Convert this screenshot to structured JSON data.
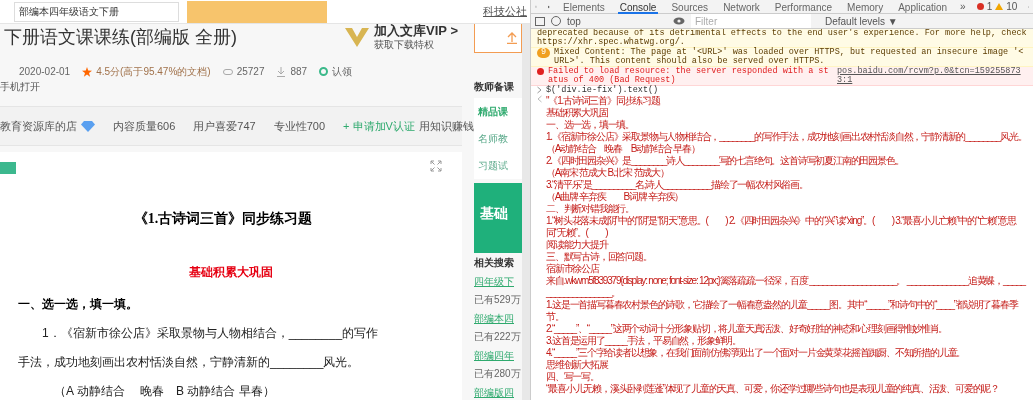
{
  "page": {
    "search_field": {
      "value": "部编本四年级语文下册"
    },
    "top_link": "科技公社",
    "doc_title": "下册语文课课练(部编版 全册)",
    "vip": {
      "title": "加入文库VIP >",
      "subtitle": "获取下载特权"
    },
    "meta": {
      "date": "2020-02-01",
      "rating": "4.5分(高于95.47%的文档)",
      "views": "25727",
      "downloads": "887",
      "claim": "认领",
      "mobile": "手机打开"
    },
    "shop_bar": {
      "shop": "教育资源库的店",
      "stats": [
        "内容质量606",
        "用户喜爱747",
        "专业性700"
      ],
      "apply": "+ 申请加V认证",
      "earn": "用知识赚钱"
    },
    "document": {
      "title": "《1.古诗词三首》同步练习题",
      "section": "基础积累大巩固",
      "heading": "一、选一选，填一填。",
      "lines": [
        {
          "kind": "indent",
          "text": "1．《宿新市徐公店》采取景物与人物相结合，________的写作"
        },
        {
          "kind": "plain",
          "text": "手法，成功地刻画出农村恬淡自然，宁静清新的________风光。"
        },
        {
          "kind": "option",
          "text": "（A 动静结合　 晚春　B 动静结合  早春）"
        }
      ]
    },
    "sidebar": {
      "heading": "教师备课",
      "tabs": [
        "精品课",
        "名师教",
        "习题试"
      ],
      "ad_text": "基础",
      "related_heading": "相关搜索",
      "related": [
        {
          "link": "四年级下",
          "count": "已有529万"
        },
        {
          "link": "部编本四",
          "count": "已有222万"
        },
        {
          "link": "部编四年",
          "count": "已有280万"
        },
        {
          "link": "部编版四"
        }
      ]
    }
  },
  "devtools": {
    "tabs": [
      {
        "label": "Elements",
        "selected": false
      },
      {
        "label": "Console",
        "selected": true
      },
      {
        "label": "Sources",
        "selected": false
      },
      {
        "label": "Network",
        "selected": false
      },
      {
        "label": "Performance",
        "selected": false
      },
      {
        "label": "Memory",
        "selected": false
      },
      {
        "label": "Application",
        "selected": false
      }
    ],
    "more": "»",
    "errors": "1",
    "warnings": "10",
    "context": "top",
    "filter_placeholder": "Filter",
    "levels": "Default levels ▼",
    "messages": [
      {
        "kind": "warning",
        "text": "deprecated because of its detrimental effects to the end user's experience. For more help, check https://xhr.spec.whatwg.org/."
      },
      {
        "kind": "warning",
        "badge": "9",
        "text": "Mixed Content: The page at '<URL>' was loaded over HTTPS, but requested an insecure image '<URL>'. This content should also be served over HTTPS."
      },
      {
        "kind": "error",
        "text": "Failed to load resource: the server responded with a status of 400 (Bad Request)",
        "source": "pos.baidu.com/rcvm?p.0&tcn=1592558733:1"
      },
      {
        "kind": "input",
        "text": "$('div.ie-fix').text()"
      }
    ],
    "output": [
      "\"《1.古诗词三首》同步练习题",
      "基础积累大巩固",
      "一、选一选，填一填。",
      "1.《宿新市徐公店》采取景物与人物相结合，________的写作手法，成功地刻画出农村恬淡自然，宁静清新的________风光。",
      "（A动静结合　晚春　B动静结合 早春）",
      "2.《四时田园杂兴》是________诗人________写的七言绝句。这首诗写初夏江南的田园景色。",
      "（A南宋 范成大 B.北宋 范成大）",
      "3.“清平乐”是__________名,诗人___________描绘了一幅农村风俗画。",
      "（A曲牌 辛弃疾　　B词牌 辛弃疾）",
      "二、判断对错我能行。",
      "1.“树头花落未成阴”中的“阴”是“阴天”意思。(　　) 2.《四时田园杂兴》中的“兴”读“xìng”。(　　) 3.“最喜小儿亡赖”中的“亡赖”意思同“无赖”。(　　)",
      "阅读能力大提升",
      "三、默写古诗，回答问题。",
      "宿新市徐公店",
      "来自.wkwm5f839379{display: none; font-size: 12px;}篱落疏疏一径深，百度 ____________________。 ______________追黄蝶，____________________。",
      "1.这是一首描写暮春农村景色的诗歌，它描绘了一幅春意盎然的儿童_____图。其中“_____”和诗句中的“____”都说明了暮春季节。",
      "2.“_____”、“_____”这两个动词十分形象贴切，将儿童天真活泼、好奇好胜的神态和心理刻画得惟妙惟肖。",
      "3.这首是运用了_____手法，平易自然，形象鲜明。",
      "4.“_____”三个字给读者以想象，在我们面前仿佛浮现出了一个面对一片金黄菜花摇首踟蹰、不知所措的儿童。",
      "思维创新大拓展",
      "四、写一写。",
      "“最喜小儿无赖，溪头卧剥莲蓬”体现了儿童的天真、可爱，你还学过哪些诗句也是表现儿童的纯真、活泼、可爱的呢？"
    ]
  }
}
